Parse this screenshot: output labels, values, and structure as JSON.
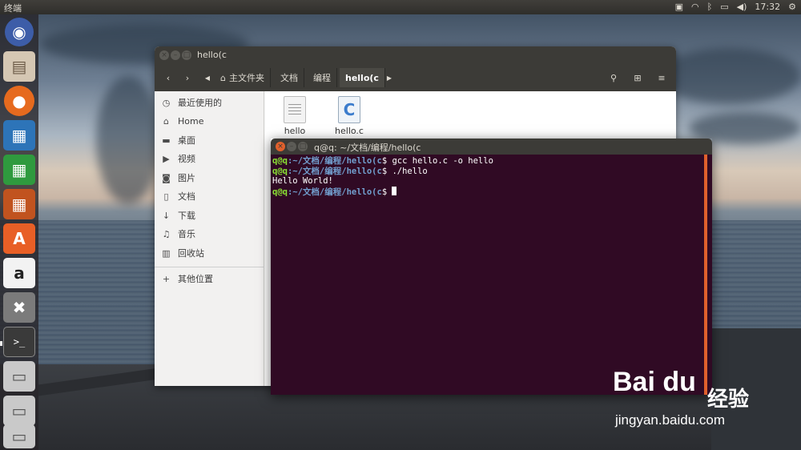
{
  "top_panel": {
    "app_title": "终端",
    "indicators": [
      "keyboard-icon",
      "wifi-icon",
      "bluetooth-icon",
      "battery-icon",
      "volume-icon"
    ],
    "clock": "17:32"
  },
  "launcher": {
    "items": [
      {
        "name": "ubuntu-logo",
        "glyph": "◉"
      },
      {
        "name": "files",
        "glyph": "▤"
      },
      {
        "name": "firefox",
        "glyph": "●"
      },
      {
        "name": "libreoffice-writer",
        "glyph": "▦"
      },
      {
        "name": "libreoffice-calc",
        "glyph": "▦"
      },
      {
        "name": "libreoffice-impress",
        "glyph": "▦"
      },
      {
        "name": "software-center",
        "glyph": "A"
      },
      {
        "name": "amazon",
        "glyph": "a"
      },
      {
        "name": "system-settings",
        "glyph": "✖"
      },
      {
        "name": "terminal",
        "glyph": ">_"
      },
      {
        "name": "drive-1",
        "glyph": "▭"
      },
      {
        "name": "drive-2",
        "glyph": "▭"
      },
      {
        "name": "drive-3",
        "glyph": "▭"
      }
    ]
  },
  "file_manager": {
    "title": "hello(c",
    "breadcrumbs": [
      "主文件夹",
      "文档",
      "编程",
      "hello(c"
    ],
    "sidebar": [
      {
        "label": "最近使用的",
        "icon": "clock-icon",
        "glyph": "◷"
      },
      {
        "label": "Home",
        "icon": "home-icon",
        "glyph": "⌂"
      },
      {
        "label": "桌面",
        "icon": "folder-icon",
        "glyph": "▬"
      },
      {
        "label": "视频",
        "icon": "video-icon",
        "glyph": "▶"
      },
      {
        "label": "图片",
        "icon": "camera-icon",
        "glyph": "◙"
      },
      {
        "label": "文档",
        "icon": "document-icon",
        "glyph": "▯"
      },
      {
        "label": "下载",
        "icon": "download-icon",
        "glyph": "↓"
      },
      {
        "label": "音乐",
        "icon": "music-icon",
        "glyph": "♫"
      },
      {
        "label": "回收站",
        "icon": "trash-icon",
        "glyph": "▥"
      }
    ],
    "other_locations": "其他位置",
    "files": [
      {
        "name": "hello",
        "type": "binary"
      },
      {
        "name": "hello.c",
        "type": "c-source"
      }
    ]
  },
  "terminal": {
    "title": "q@q: ~/文档/编程/hello(c",
    "lines": [
      {
        "user": "q@q",
        "path": ":~/文档/编程/hello(c",
        "cmd": "$ gcc hello.c -o hello"
      },
      {
        "user": "q@q",
        "path": ":~/文档/编程/hello(c",
        "cmd": "$ ./hello"
      },
      {
        "output": "Hello World!"
      },
      {
        "user": "q@q",
        "path": ":~/文档/编程/hello(c",
        "cmd": "$ "
      }
    ]
  },
  "watermark": {
    "brand": "Bai du",
    "cn": "经验",
    "url": "jingyan.baidu.com"
  }
}
